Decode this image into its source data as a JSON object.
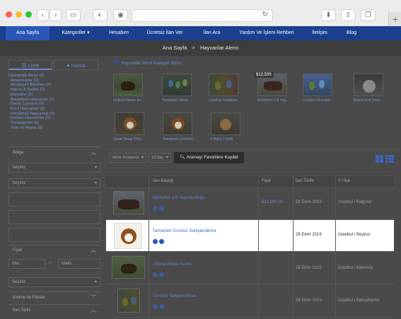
{
  "nav": {
    "items": [
      "Ana Sayfa",
      "Kategoriler ▾",
      "Hesabım",
      "Ücretsiz İlan Ver",
      "İlan Ara",
      "Yardım Ve İşlem Rehberi",
      "İletişim",
      "Blog"
    ]
  },
  "breadcrumb": {
    "home": "Ana Sayfa",
    "sep": ">",
    "current": "Hayvanlar Alemi"
  },
  "sidebar": {
    "tab_list": "Liste",
    "tab_map": "Harita",
    "categories": [
      "Hayvanlar Alemi (9)",
      "Akaesuarlar (0)",
      "Akvaryum Balıkları (0)",
      "Bakım & Sağlık (0)",
      "Böcekler (0)",
      "Büyükbaş Hayvanlar (1)",
      "Deniz Canlıları (0)",
      "Evcil Hayvanlar (8)",
      "Küçükbaş Hayvanlar (0)",
      "Kümes Hayvanları (0)",
      "Sürüngenler (0)",
      "Yem ve Mama (0)"
    ],
    "bolge_label": "Bölge",
    "seciniz1": "Seçiniz",
    "seciniz2": "Seçiniz",
    "fiyat_label": "Fiyat",
    "min_placeholder": "Min.",
    "dash": "–",
    "max_placeholder": "Maks.",
    "seciniz3": "Seçiniz",
    "keyword_label": "Kelime ile Filtrele",
    "date_label": "İlan Tarihi"
  },
  "vitrin": {
    "title": "Hayvanlar Alemi Kategori Vitrini",
    "price_badge": "$12,500",
    "items": [
      "Orijinal Alman Ku...",
      "Yumurtalı Takım ...",
      "Ücretsiz Sahiplen...",
      "Montofon 1.5 Yaş...",
      "Ücretsiz Muhabb...",
      "Bebek Acil Yuva ...",
      "Uysal Sevgi Dolu ...",
      "Tamamen Ücretsiz ...",
      "5 Aylık 2 Kedi"
    ]
  },
  "toolbar": {
    "sort": "Akıllı Sıralama",
    "count": "10 İlan",
    "save": "Aramayı Favorilere Kaydet"
  },
  "table": {
    "headers": [
      "İlan Başlığı",
      "Fiyat",
      "İlan Tarihi",
      "İl / İlçe"
    ],
    "rows": [
      {
        "title": "Montofon 1.5 Yaşında Boğa",
        "price": "$12,500.00",
        "date": "28 Ekim 2019",
        "loc": "İstanbul / Bağcılar"
      },
      {
        "title": "Tamamen Ücretsiz Sahiplendirme",
        "price": "",
        "date": "28 Ekim 2019",
        "loc": "İstanbul / Beykoz"
      },
      {
        "title": "Orijinal Alman Kurdu",
        "price": "",
        "date": "28 Ekim 2019",
        "loc": "İstanbul / Bakırköy"
      },
      {
        "title": "Ücretsiz Sahiplendirme",
        "price": "",
        "date": "28 Ekim 2019",
        "loc": "İstanbul / Bahçelievler"
      }
    ]
  },
  "colors": {
    "nav": "#1b3f8f",
    "accent": "#2a56b8",
    "link": "#3e6bc5"
  }
}
